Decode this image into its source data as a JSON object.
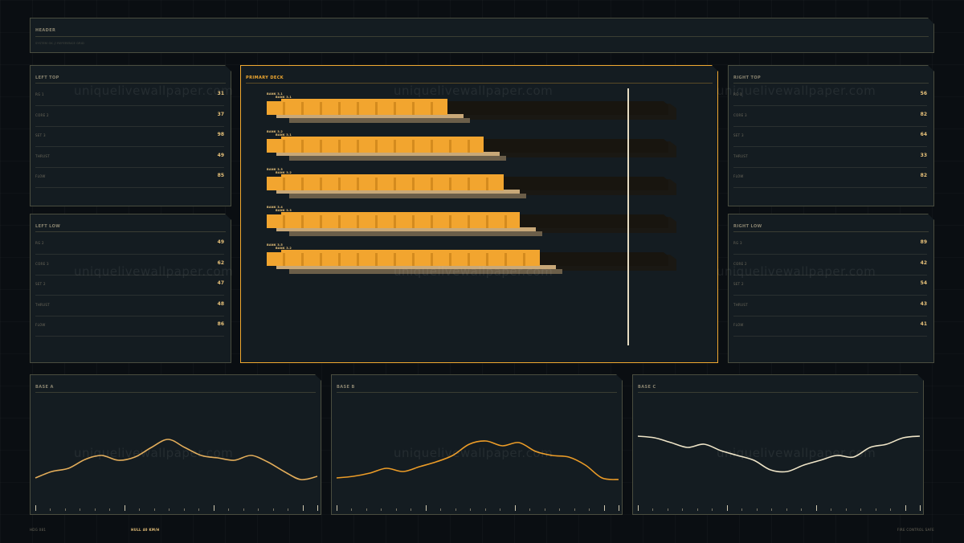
{
  "header": {
    "title": "HEADER",
    "subtitle": "SYSTEM OK // REFERENCE GRID"
  },
  "panels": {
    "left_top": {
      "title": "LEFT TOP",
      "rows": [
        {
          "label": "RG 1",
          "value": "31"
        },
        {
          "label": "CORE 2",
          "value": "37"
        },
        {
          "label": "SET 3",
          "value": "98"
        },
        {
          "label": "THRUST",
          "value": "49"
        },
        {
          "label": "FLOW",
          "value": "85"
        }
      ]
    },
    "left_low": {
      "title": "LEFT LOW",
      "rows": [
        {
          "label": "RG 2",
          "value": "49"
        },
        {
          "label": "CORE 3",
          "value": "62"
        },
        {
          "label": "SET 2",
          "value": "47"
        },
        {
          "label": "THRUST",
          "value": "48"
        },
        {
          "label": "FLOW",
          "value": "86"
        }
      ]
    },
    "right_top": {
      "title": "RIGHT TOP",
      "rows": [
        {
          "label": "RG 1",
          "value": "56"
        },
        {
          "label": "CORE 3",
          "value": "82"
        },
        {
          "label": "SET 3",
          "value": "64"
        },
        {
          "label": "THRUST",
          "value": "33"
        },
        {
          "label": "FLOW",
          "value": "82"
        }
      ]
    },
    "right_low": {
      "title": "RIGHT LOW",
      "rows": [
        {
          "label": "RG 3",
          "value": "89"
        },
        {
          "label": "CORE 2",
          "value": "42"
        },
        {
          "label": "SET 2",
          "value": "54"
        },
        {
          "label": "THRUST",
          "value": "43"
        },
        {
          "label": "FLOW",
          "value": "41"
        }
      ]
    }
  },
  "primary_deck": {
    "title": "PRIMARY DECK",
    "banks": [
      {
        "label": "BANK 3.1",
        "sublabel": "BANK 3.1",
        "level": 0.45
      },
      {
        "label": "BANK 3.2",
        "sublabel": "BANK 3.1",
        "level": 0.54
      },
      {
        "label": "BANK 3.3",
        "sublabel": "BANK 3.2",
        "level": 0.59
      },
      {
        "label": "BANK 3.4",
        "sublabel": "BANK 3.3",
        "level": 0.63
      },
      {
        "label": "BANK 3.5",
        "sublabel": "BANK 3.2",
        "level": 0.68
      }
    ]
  },
  "bases": [
    {
      "title": "BASE A",
      "color": "#e3ad5a",
      "values": [
        0.22,
        0.3,
        0.34,
        0.45,
        0.5,
        0.44,
        0.48,
        0.6,
        0.7,
        0.6,
        0.5,
        0.47,
        0.44,
        0.5,
        0.42,
        0.3,
        0.2,
        0.24
      ]
    },
    {
      "title": "BASE B",
      "color": "#ec9c27",
      "values": [
        0.22,
        0.24,
        0.28,
        0.34,
        0.3,
        0.36,
        0.42,
        0.5,
        0.64,
        0.68,
        0.62,
        0.66,
        0.55,
        0.5,
        0.48,
        0.38,
        0.22,
        0.2
      ]
    },
    {
      "title": "BASE C",
      "color": "#efe5c8",
      "values": [
        0.74,
        0.72,
        0.66,
        0.6,
        0.64,
        0.56,
        0.5,
        0.44,
        0.32,
        0.3,
        0.38,
        0.44,
        0.5,
        0.48,
        0.6,
        0.64,
        0.72,
        0.74
      ]
    }
  ],
  "footer": {
    "left": "HDG 081",
    "center": "HULL 40 KM/H",
    "right": "FIRE CONTROL SAFE"
  },
  "watermark": "uniquelivewallpaper.com"
}
